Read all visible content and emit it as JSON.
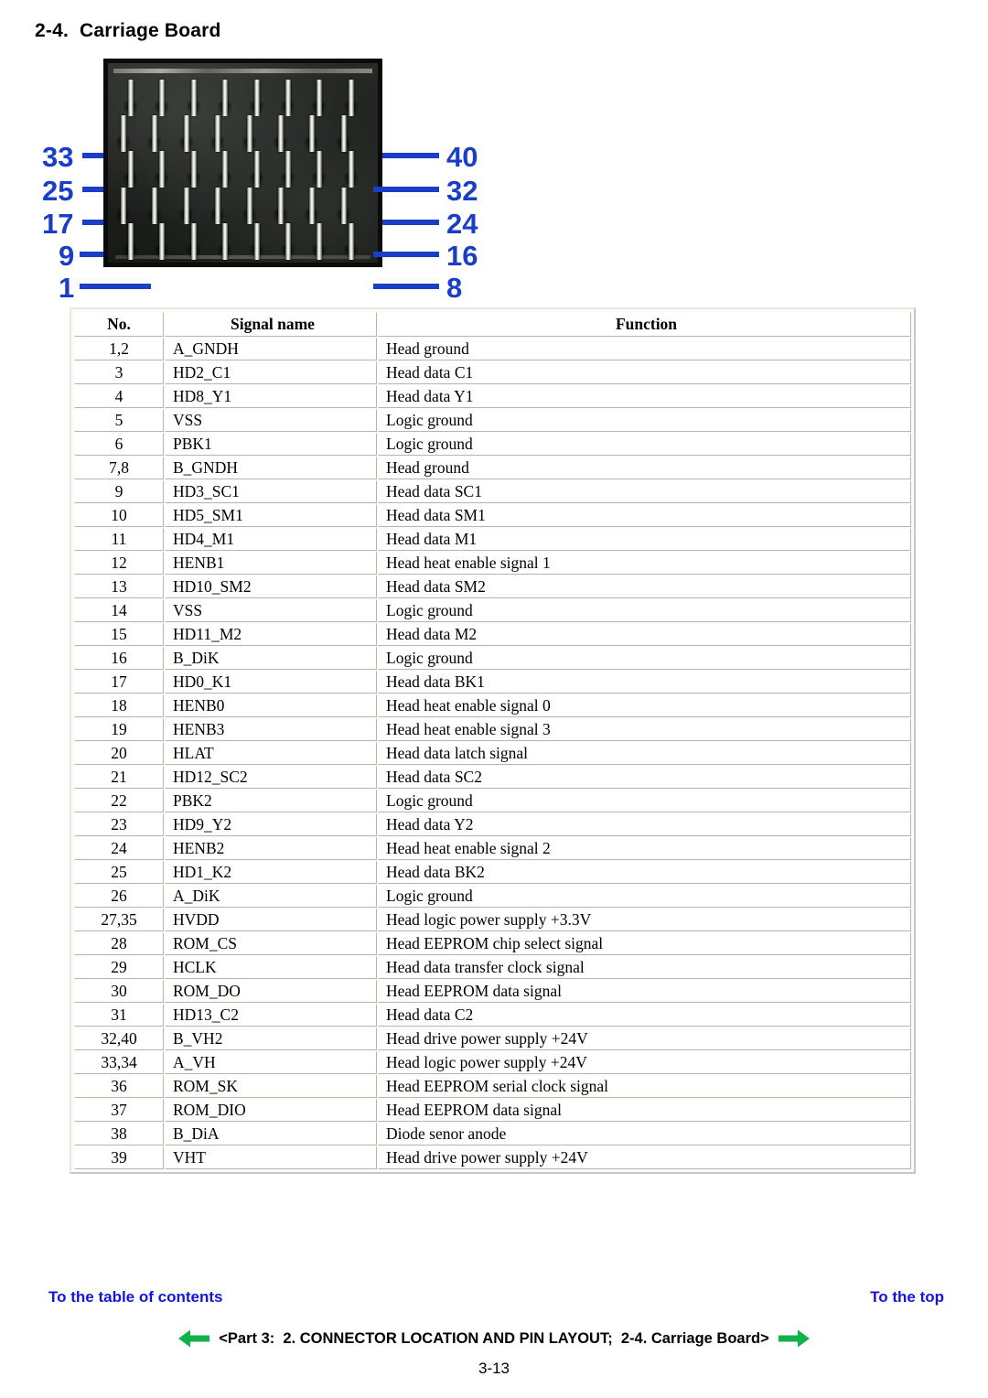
{
  "document": {
    "section_number": "2-4.",
    "title": "2-4.  Carriage Board",
    "page_number": "3-13"
  },
  "figure": {
    "name": "carriage-board-connector-photo",
    "left_callouts": [
      "33",
      "25",
      "17",
      "9",
      "1"
    ],
    "right_callouts": [
      "40",
      "32",
      "24",
      "16",
      "8"
    ],
    "callout_color": "#1A3EC8",
    "pin_count": 40,
    "grid_rows": 5,
    "grid_cols": 8
  },
  "table": {
    "headers": [
      "No.",
      "Signal name",
      "Function"
    ],
    "rows": [
      {
        "no": "1,2",
        "signal": "A_GNDH",
        "function": "Head ground"
      },
      {
        "no": "3",
        "signal": "HD2_C1",
        "function": "Head data C1"
      },
      {
        "no": "4",
        "signal": "HD8_Y1",
        "function": "Head data Y1"
      },
      {
        "no": "5",
        "signal": "VSS",
        "function": "Logic ground"
      },
      {
        "no": "6",
        "signal": "PBK1",
        "function": "Logic ground"
      },
      {
        "no": "7,8",
        "signal": "B_GNDH",
        "function": "Head ground"
      },
      {
        "no": "9",
        "signal": "HD3_SC1",
        "function": "Head data SC1"
      },
      {
        "no": "10",
        "signal": "HD5_SM1",
        "function": "Head data SM1"
      },
      {
        "no": "11",
        "signal": "HD4_M1",
        "function": "Head data M1"
      },
      {
        "no": "12",
        "signal": "HENB1",
        "function": "Head heat enable signal 1"
      },
      {
        "no": "13",
        "signal": "HD10_SM2",
        "function": "Head data SM2"
      },
      {
        "no": "14",
        "signal": "VSS",
        "function": "Logic ground"
      },
      {
        "no": "15",
        "signal": "HD11_M2",
        "function": "Head data M2"
      },
      {
        "no": "16",
        "signal": "B_DiK",
        "function": "Logic ground"
      },
      {
        "no": "17",
        "signal": "HD0_K1",
        "function": "Head data BK1"
      },
      {
        "no": "18",
        "signal": "HENB0",
        "function": "Head heat enable signal 0"
      },
      {
        "no": "19",
        "signal": "HENB3",
        "function": "Head heat enable signal 3"
      },
      {
        "no": "20",
        "signal": "HLAT",
        "function": "Head data latch signal"
      },
      {
        "no": "21",
        "signal": "HD12_SC2",
        "function": "Head data SC2"
      },
      {
        "no": "22",
        "signal": "PBK2",
        "function": "Logic ground"
      },
      {
        "no": "23",
        "signal": "HD9_Y2",
        "function": "Head data Y2"
      },
      {
        "no": "24",
        "signal": "HENB2",
        "function": "Head heat enable signal 2"
      },
      {
        "no": "25",
        "signal": "HD1_K2",
        "function": "Head data BK2"
      },
      {
        "no": "26",
        "signal": "A_DiK",
        "function": "Logic ground"
      },
      {
        "no": "27,35",
        "signal": "HVDD",
        "function": "Head logic power supply +3.3V"
      },
      {
        "no": "28",
        "signal": "ROM_CS",
        "function": "Head EEPROM chip select signal"
      },
      {
        "no": "29",
        "signal": "HCLK",
        "function": "Head data transfer clock signal"
      },
      {
        "no": "30",
        "signal": "ROM_DO",
        "function": "Head EEPROM data signal"
      },
      {
        "no": "31",
        "signal": "HD13_C2",
        "function": "Head data C2"
      },
      {
        "no": "32,40",
        "signal": "B_VH2",
        "function": "Head drive power supply +24V"
      },
      {
        "no": "33,34",
        "signal": "A_VH",
        "function": "Head logic power supply +24V"
      },
      {
        "no": "36",
        "signal": "ROM_SK",
        "function": "Head EEPROM serial clock signal"
      },
      {
        "no": "37",
        "signal": "ROM_DIO",
        "function": "Head EEPROM data signal"
      },
      {
        "no": "38",
        "signal": "B_DiA",
        "function": "Diode senor anode"
      },
      {
        "no": "39",
        "signal": "VHT",
        "function": "Head drive power supply +24V"
      }
    ]
  },
  "footer": {
    "toc_link": "To the table of contents",
    "top_link": "To the top",
    "breadcrumb": "<Part 3:  2. CONNECTOR LOCATION AND PIN LAYOUT;  2-4. Carriage Board>",
    "link_color": "#1414E0",
    "arrow_color": "#11B24C"
  }
}
